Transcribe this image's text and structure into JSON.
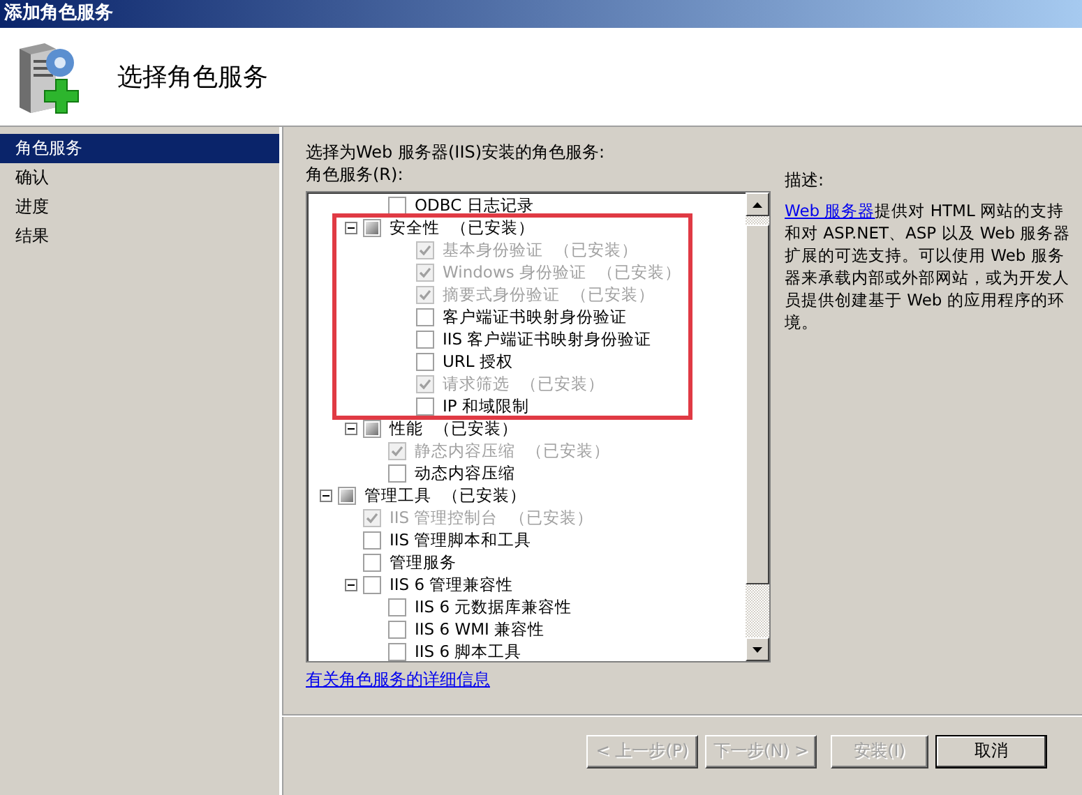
{
  "window": {
    "title": "添加角色服务"
  },
  "header": {
    "title": "选择角色服务"
  },
  "sidebar": {
    "items": [
      {
        "label": "角色服务",
        "selected": true
      },
      {
        "label": "确认",
        "selected": false
      },
      {
        "label": "进度",
        "selected": false
      },
      {
        "label": "结果",
        "selected": false
      }
    ]
  },
  "content": {
    "intro": "选择为Web 服务器(IIS)安装的角色服务:",
    "list_label": "角色服务(R):",
    "tree": [
      {
        "kind": "continued",
        "children": [
          {
            "kind": "continued",
            "children": [
              {
                "kind": "item",
                "label": "ODBC 日志记录",
                "checked": false,
                "disabled": false
              }
            ]
          },
          {
            "kind": "item",
            "label": "安全性",
            "note": "（已安装）",
            "checked": false,
            "mixed": true,
            "disabled": false,
            "expanded": true,
            "highlighted": true,
            "children": [
              {
                "kind": "item",
                "label": "基本身份验证",
                "note": "（已安装）",
                "checked": true,
                "disabled": true
              },
              {
                "kind": "item",
                "label": "Windows 身份验证",
                "note": "（已安装）",
                "checked": true,
                "disabled": true
              },
              {
                "kind": "item",
                "label": "摘要式身份验证",
                "note": "（已安装）",
                "checked": true,
                "disabled": true
              },
              {
                "kind": "item",
                "label": "客户端证书映射身份验证",
                "checked": false,
                "disabled": false
              },
              {
                "kind": "item",
                "label": "IIS 客户端证书映射身份验证",
                "checked": false,
                "disabled": false
              },
              {
                "kind": "item",
                "label": "URL 授权",
                "checked": false,
                "disabled": false
              },
              {
                "kind": "item",
                "label": "请求筛选",
                "note": "（已安装）",
                "checked": true,
                "disabled": true
              },
              {
                "kind": "item",
                "label": "IP 和域限制",
                "checked": false,
                "disabled": false
              }
            ]
          },
          {
            "kind": "item",
            "label": "性能",
            "note": "（已安装）",
            "checked": false,
            "mixed": true,
            "disabled": false,
            "expanded": true,
            "children": [
              {
                "kind": "item",
                "label": "静态内容压缩",
                "note": "（已安装）",
                "checked": true,
                "disabled": true
              },
              {
                "kind": "item",
                "label": "动态内容压缩",
                "checked": false,
                "disabled": false
              }
            ]
          }
        ]
      },
      {
        "kind": "item",
        "label": "管理工具",
        "note": "（已安装）",
        "checked": false,
        "mixed": true,
        "disabled": false,
        "expanded": true,
        "children": [
          {
            "kind": "item",
            "label": "IIS 管理控制台",
            "note": "（已安装）",
            "checked": true,
            "disabled": true
          },
          {
            "kind": "item",
            "label": "IIS 管理脚本和工具",
            "checked": false,
            "disabled": false
          },
          {
            "kind": "item",
            "label": "管理服务",
            "checked": false,
            "disabled": false
          },
          {
            "kind": "item",
            "label": "IIS 6 管理兼容性",
            "checked": false,
            "mixed": false,
            "disabled": false,
            "expanded": true,
            "children": [
              {
                "kind": "item",
                "label": "IIS 6 元数据库兼容性",
                "checked": false,
                "disabled": false
              },
              {
                "kind": "item",
                "label": "IIS 6 WMI 兼容性",
                "checked": false,
                "disabled": false
              },
              {
                "kind": "item",
                "label": "IIS 6 脚本工具",
                "checked": false,
                "disabled": false
              }
            ]
          }
        ]
      }
    ],
    "more_link": "有关角色服务的详细信息",
    "description": {
      "heading": "描述:",
      "link": "Web 服务器",
      "text": "提供对 HTML 网站的支持和对 ASP.NET、ASP 以及 Web 服务器扩展的可选支持。可以使用 Web 服务器来承载内部或外部网站，或为开发人员提供创建基于 Web 的应用程序的环境。"
    }
  },
  "buttons": [
    {
      "label": "< 上一步(P)",
      "disabled": true
    },
    {
      "label": "下一步(N) >",
      "disabled": true
    },
    {
      "label": "安装(I)",
      "disabled": true
    },
    {
      "label": "取消",
      "disabled": false
    }
  ]
}
